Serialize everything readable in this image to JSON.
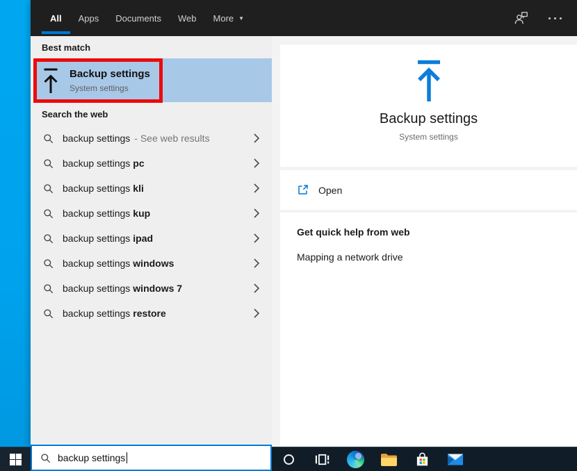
{
  "topbar": {
    "tabs": [
      {
        "label": "All",
        "active": true
      },
      {
        "label": "Apps"
      },
      {
        "label": "Documents"
      },
      {
        "label": "Web"
      },
      {
        "label": "More",
        "caret": true
      }
    ],
    "icons": [
      "feedback-user-icon",
      "more-options-ellipsis-icon"
    ]
  },
  "left_panel": {
    "best_match_label": "Best match",
    "best_match": {
      "title": "Backup settings",
      "subtitle": "System settings",
      "icon": "backup-arrow-icon"
    },
    "search_web_label": "Search the web",
    "suggestions": [
      {
        "prefix": "backup settings",
        "bold": "",
        "note": "- See web results"
      },
      {
        "prefix": "backup settings",
        "bold": "pc",
        "note": ""
      },
      {
        "prefix": "backup settings",
        "bold": "kli",
        "note": ""
      },
      {
        "prefix": "backup settings",
        "bold": "kup",
        "note": ""
      },
      {
        "prefix": "backup settings",
        "bold": "ipad",
        "note": ""
      },
      {
        "prefix": "backup settings",
        "bold": "windows",
        "note": ""
      },
      {
        "prefix": "backup settings",
        "bold": "windows 7",
        "note": ""
      },
      {
        "prefix": "backup settings",
        "bold": "restore",
        "note": ""
      }
    ]
  },
  "preview": {
    "icon": "backup-arrow-icon",
    "title": "Backup settings",
    "subtitle": "System settings",
    "open_label": "Open",
    "help_header": "Get quick help from web",
    "help_link": "Mapping a network drive"
  },
  "taskbar": {
    "search_value": "backup settings",
    "icons": [
      "start-button",
      "cortana-icon",
      "task-view-icon",
      "edge-icon",
      "file-explorer-icon",
      "microsoft-store-icon",
      "mail-icon"
    ]
  },
  "annotation": {
    "type": "highlight-box",
    "color": "#ee0a0a"
  },
  "colors": {
    "accent": "#0078d4",
    "best_match_highlight": "#a8c8e8",
    "desktop_blue": "#00a2ed",
    "topbar_bg": "#1f1f1f",
    "panel_bg": "#efefef",
    "card_bg": "#ffffff",
    "taskbar_bg": "#101d29"
  }
}
